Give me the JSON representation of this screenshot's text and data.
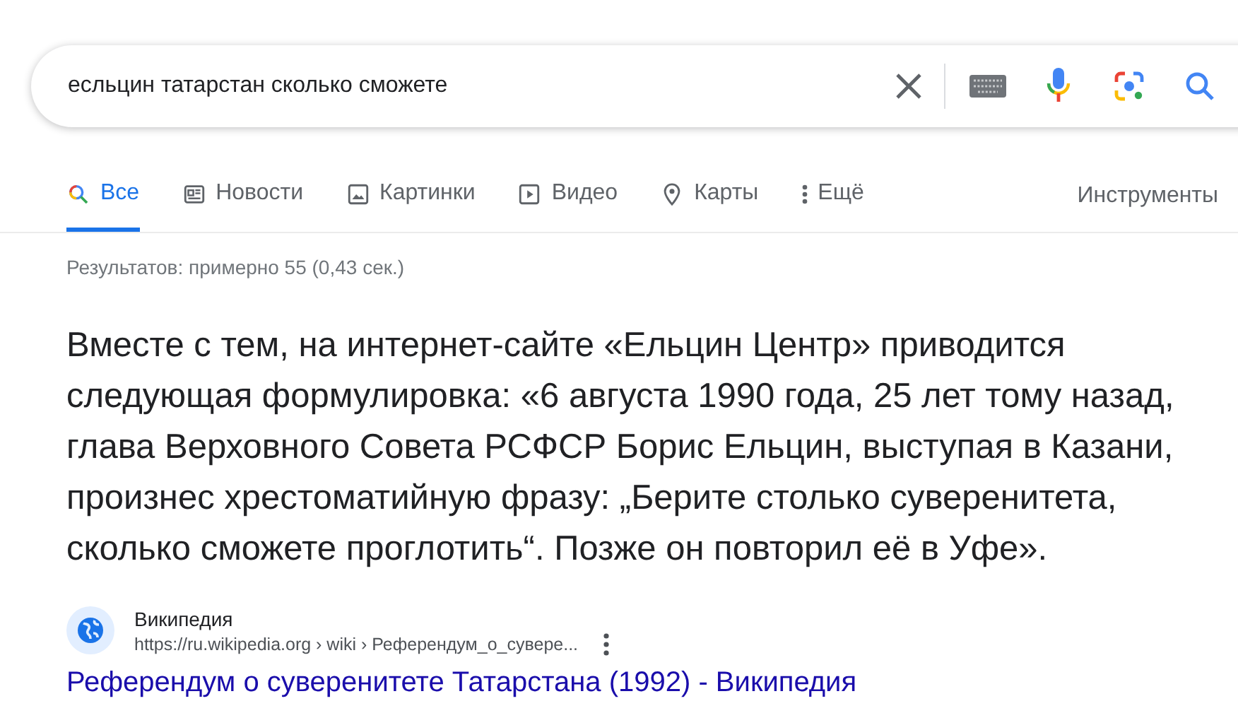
{
  "search": {
    "value": "есльцин татарстан сколько сможете"
  },
  "tabs": [
    {
      "label": "Все",
      "kind": "all",
      "selected": true
    },
    {
      "label": "Новости",
      "kind": "news",
      "selected": false
    },
    {
      "label": "Картинки",
      "kind": "images",
      "selected": false
    },
    {
      "label": "Видео",
      "kind": "video",
      "selected": false
    },
    {
      "label": "Карты",
      "kind": "maps",
      "selected": false
    },
    {
      "label": "Ещё",
      "kind": "more",
      "selected": false
    }
  ],
  "tools": "Инструменты",
  "stats": "Результатов: примерно 55 (0,43 сек.)",
  "snippet": "Вместе с тем, на интернет-сайте «Ельцин Центр» приводится следующая формулировка: «6 августа 1990 года, 25 лет тому назад, глава Верховного Совета РСФСР Борис Ельцин, выступая в Казани, произнес хрестоматийную фразу: „Берите столько суверенитета, сколько сможете проглотить“. Позже он повторил её в Уфе».",
  "source": {
    "name": "Википедия",
    "url": "https://ru.wikipedia.org › wiki › Референдум_о_сувере...",
    "title": "Референдум о суверенитете Татарстана (1992) - Википедия"
  }
}
